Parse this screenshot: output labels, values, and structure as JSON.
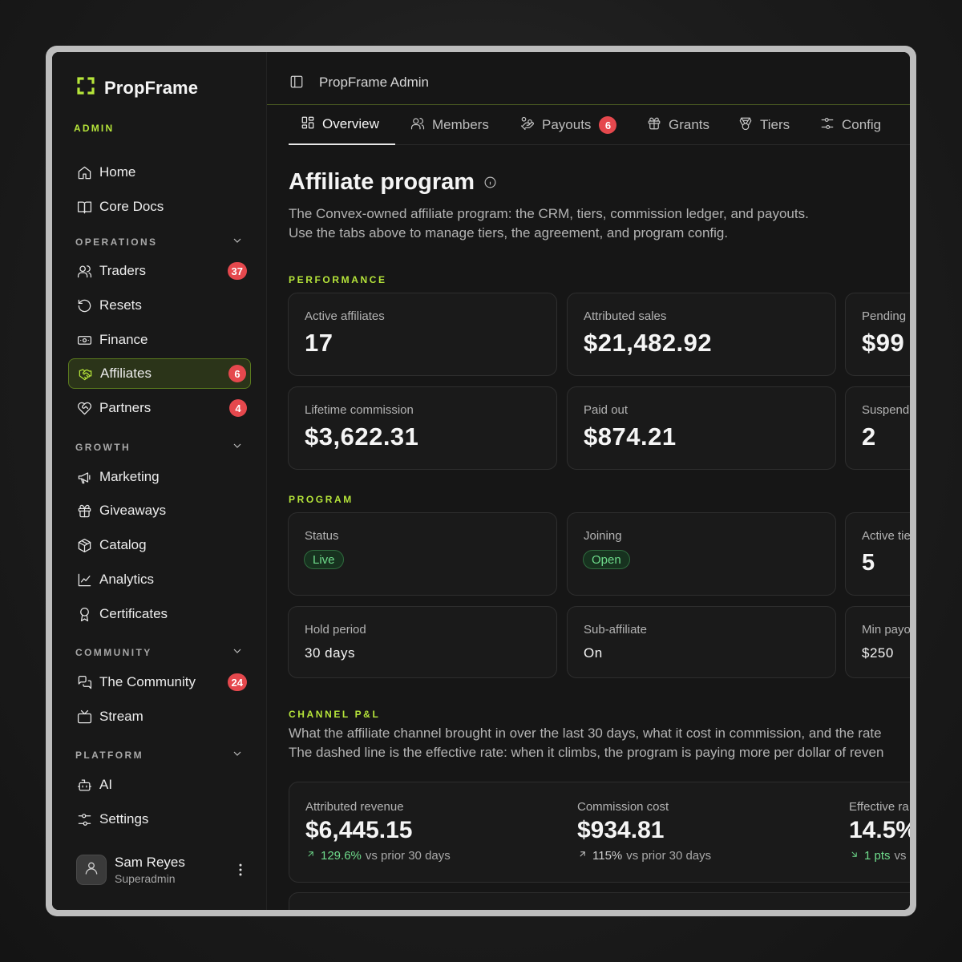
{
  "brand": {
    "name": "PropFrame",
    "accent": "#b6e53a"
  },
  "sidebar": {
    "admin_label": "ADMIN",
    "top_items": [
      {
        "label": "Home",
        "icon": "home-icon"
      },
      {
        "label": "Core Docs",
        "icon": "book-icon"
      }
    ],
    "sections": {
      "operations": "OPERATIONS",
      "growth": "GROWTH",
      "community": "COMMUNITY",
      "platform": "PLATFORM"
    },
    "operations_items": [
      {
        "label": "Traders",
        "badge": "37",
        "icon": "users-icon"
      },
      {
        "label": "Resets",
        "icon": "reset-icon"
      },
      {
        "label": "Finance",
        "icon": "banknote-icon"
      },
      {
        "label": "Affiliates",
        "badge": "6",
        "icon": "handshake-icon",
        "active": true
      },
      {
        "label": "Partners",
        "badge": "4",
        "icon": "heart-handshake-icon"
      }
    ],
    "growth_items": [
      {
        "label": "Marketing",
        "icon": "megaphone-icon"
      },
      {
        "label": "Giveaways",
        "icon": "gift-icon"
      },
      {
        "label": "Catalog",
        "icon": "box-icon"
      },
      {
        "label": "Analytics",
        "icon": "chart-icon"
      },
      {
        "label": "Certificates",
        "icon": "award-icon"
      }
    ],
    "community_items": [
      {
        "label": "The Community",
        "badge": "24",
        "icon": "messages-icon"
      },
      {
        "label": "Stream",
        "icon": "tv-icon"
      }
    ],
    "platform_items": [
      {
        "label": "AI",
        "icon": "bot-icon"
      },
      {
        "label": "Settings",
        "icon": "settings-icon"
      }
    ],
    "user": {
      "name": "Sam Reyes",
      "role": "Superadmin"
    }
  },
  "topbar": {
    "title": "PropFrame Admin"
  },
  "tabs": [
    {
      "label": "Overview",
      "active": true
    },
    {
      "label": "Members"
    },
    {
      "label": "Payouts",
      "badge": "6"
    },
    {
      "label": "Grants"
    },
    {
      "label": "Tiers"
    },
    {
      "label": "Config"
    }
  ],
  "page": {
    "title": "Affiliate program",
    "desc_line1": "The Convex-owned affiliate program: the CRM, tiers, commission ledger, and payouts.",
    "desc_line2": "Use the tabs above to manage tiers, the agreement, and program config."
  },
  "performance": {
    "label": "PERFORMANCE",
    "cards": [
      {
        "label": "Active affiliates",
        "value": "17"
      },
      {
        "label": "Attributed sales",
        "value": "$21,482.92"
      },
      {
        "label": "Pending",
        "value": "$99"
      },
      {
        "label": "Lifetime commission",
        "value": "$3,622.31"
      },
      {
        "label": "Paid out",
        "value": "$874.21"
      },
      {
        "label": "Suspend",
        "value": "2"
      }
    ]
  },
  "program": {
    "label": "PROGRAM",
    "cards": [
      {
        "label": "Status",
        "pill": "Live"
      },
      {
        "label": "Joining",
        "pill": "Open"
      },
      {
        "label": "Active tie",
        "value": "5"
      },
      {
        "label": "Hold period",
        "value": "30 days"
      },
      {
        "label": "Sub-affiliate",
        "value": "On"
      },
      {
        "label": "Min payo",
        "value": "$250"
      }
    ]
  },
  "channel": {
    "label": "CHANNEL P&L",
    "desc_line1": "What the affiliate channel brought in over the last 30 days, what it cost in commission, and the rate",
    "desc_line2": "The dashed line is the effective rate: when it climbs, the program is paying more per dollar of reven",
    "metrics": [
      {
        "label": "Attributed revenue",
        "value": "$6,445.15",
        "delta": "129.6%",
        "delta_suffix": "vs prior 30 days",
        "tone": "up"
      },
      {
        "label": "Commission cost",
        "value": "$934.81",
        "delta": "115%",
        "delta_suffix": "vs prior 30 days",
        "tone": "neutral"
      },
      {
        "label": "Effective ra",
        "value": "14.5%",
        "delta": "1 pts",
        "delta_suffix": "vs",
        "tone": "up"
      }
    ]
  }
}
